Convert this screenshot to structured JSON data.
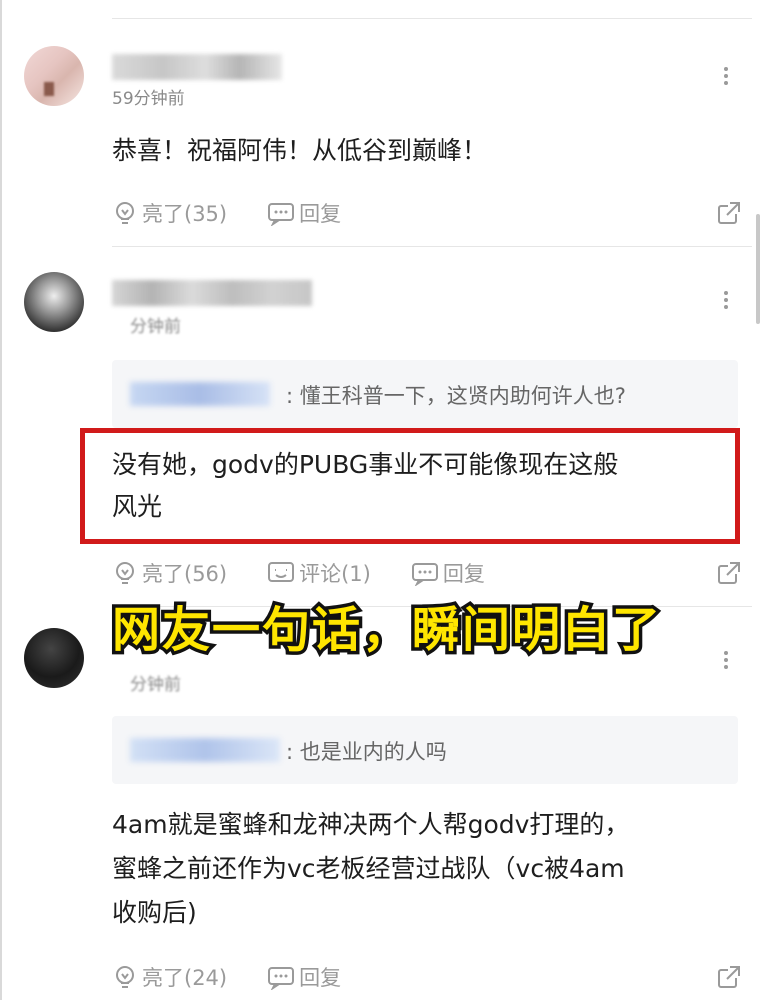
{
  "comments": [
    {
      "time": "59分钟前",
      "text": "恭喜！祝福阿伟！从低谷到巅峰！",
      "like_label": "亮了(35)",
      "reply_label": "回复"
    },
    {
      "time": "分钟前",
      "quote_text": ": 懂王科普一下，这贤内助何许人也?",
      "text_line1": "没有她，godv的PUBG事业不可能像现在这般",
      "text_line2": "风光",
      "like_label": "亮了(56)",
      "comment_label": "评论(1)",
      "reply_label": "回复"
    },
    {
      "time": "分钟前",
      "quote_text": ": 也是业内的人吗",
      "text_line1": "4am就是蜜蜂和龙神决两个人帮godv打理的，",
      "text_line2": "蜜蜂之前还作为vc老板经营过战队（vc被4am",
      "text_line3": "收购后)",
      "like_label": "亮了(24)",
      "reply_label": "回复"
    }
  ],
  "overlay_caption": "网友一句话，瞬间明白了",
  "colors": {
    "highlight_border": "#d11a1a",
    "caption_fill": "#ffe600",
    "caption_stroke": "#111111",
    "muted": "#9a9a9a"
  },
  "icons": [
    "bulb-icon",
    "reply-bubble-icon",
    "comment-icon",
    "share-icon",
    "more-vertical-icon"
  ]
}
